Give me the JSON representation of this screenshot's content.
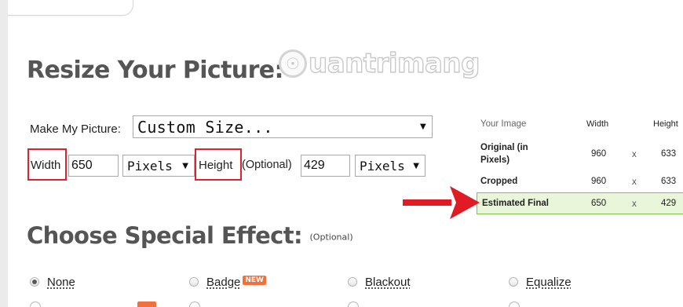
{
  "watermark": {
    "text": "uantrimang"
  },
  "resize": {
    "title": "Resize Your Picture:",
    "make_label": "Make My Picture:",
    "size_value": "Custom Size...",
    "width_label": "Width",
    "width_value": "650",
    "width_unit": "Pixels",
    "height_label": "Height",
    "height_optional": "(Optional)",
    "height_value": "429",
    "height_unit": "Pixels"
  },
  "table": {
    "headers": {
      "image": "Your Image",
      "width": "Width",
      "height": "Height"
    },
    "x": "x",
    "rows": [
      {
        "label": "Original (in Pixels)",
        "width": "960",
        "height": "633"
      },
      {
        "label": "Cropped",
        "width": "960",
        "height": "633"
      },
      {
        "label": "Estimated Final",
        "width": "650",
        "height": "429"
      }
    ]
  },
  "effects": {
    "title": "Choose Special Effect:",
    "optional": "(Optional)",
    "options": [
      {
        "label": "None",
        "checked": true
      },
      {
        "label": "Badge",
        "badge": "NEW",
        "checked": false
      },
      {
        "label": "Blackout",
        "checked": false
      },
      {
        "label": "Equalize",
        "checked": false
      }
    ]
  },
  "colors": {
    "highlight": "#e0202a",
    "arrow": "#e01b24",
    "final_bg": "#eaf6d9",
    "final_border": "#84bf4d",
    "badge": "#f36f3c"
  }
}
